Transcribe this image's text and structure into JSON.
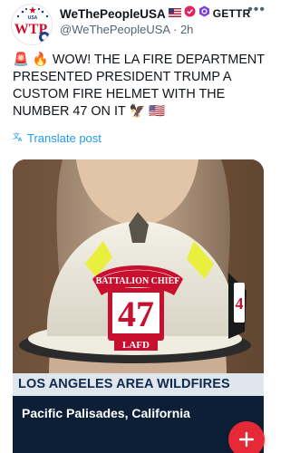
{
  "post": {
    "author_name": "WeThePeopleUSA",
    "gettr_label": "GETTR",
    "handle": "@WeThePeopleUSA",
    "time": "2h",
    "text": "🚨 🔥 WOW! THE LA FIRE DEPARTMENT PRESENTED PRESIDENT TRUMP A CUSTOM FIRE HELMET WITH THE NUMBER 47 ON IT 🦅 🇺🇸",
    "translate_label": "Translate post",
    "avatar_text": "WTP",
    "avatar_usa": "USA"
  },
  "media": {
    "helmet_front_label": "BATTALION CHIEF",
    "helmet_number": "47",
    "helmet_dept": "LAFD",
    "helmet_side_number": "4",
    "chyron_headline": "LOS ANGELES AREA WILDFIRES",
    "chyron_location": "Pacific Palisades, California"
  },
  "icons": {
    "more": "more-horizontal-icon",
    "translate": "translate-icon",
    "fab": "plus-icon"
  },
  "colors": {
    "link": "#1d9bf0",
    "fab": "#e62937",
    "chyron_dark": "#0d1f36",
    "chyron_light": "#dfe6ee"
  }
}
